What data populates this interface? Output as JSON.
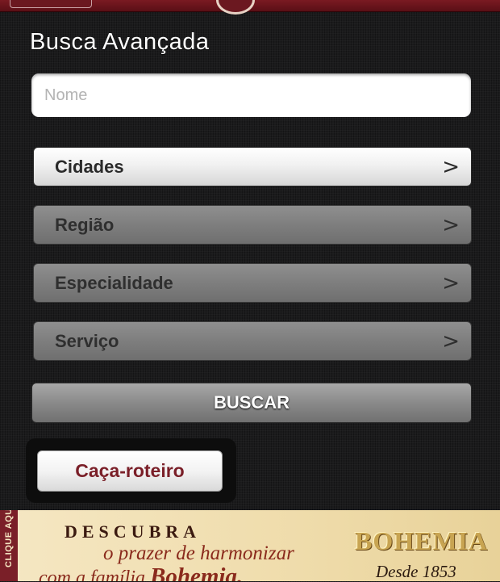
{
  "header": {
    "title": "Busca Avançada"
  },
  "search": {
    "name_placeholder": "Nome",
    "name_value": ""
  },
  "filters": [
    {
      "label": "Cidades",
      "chevron": ">"
    },
    {
      "label": "Região",
      "chevron": ">"
    },
    {
      "label": "Especialidade",
      "chevron": ">"
    },
    {
      "label": "Serviço",
      "chevron": ">"
    }
  ],
  "actions": {
    "search_label": "BUSCAR",
    "tour_label": "Caça-roteiro"
  },
  "ad": {
    "side_text": "CLIQUE AQUI",
    "line1": "DESCUBRA",
    "line2": "o prazer de harmonizar",
    "line3": "com a família",
    "line3_brand": "Bohemia.",
    "brand": "BOHEMIA",
    "since": "Desde 1853"
  },
  "colors": {
    "header_bar": "#6b1820",
    "background": "#1b1b1c",
    "accent_text": "#7a1f28"
  },
  "icons": {
    "logo": "brand-logo-icon",
    "chevron": "chevron-right-icon"
  }
}
